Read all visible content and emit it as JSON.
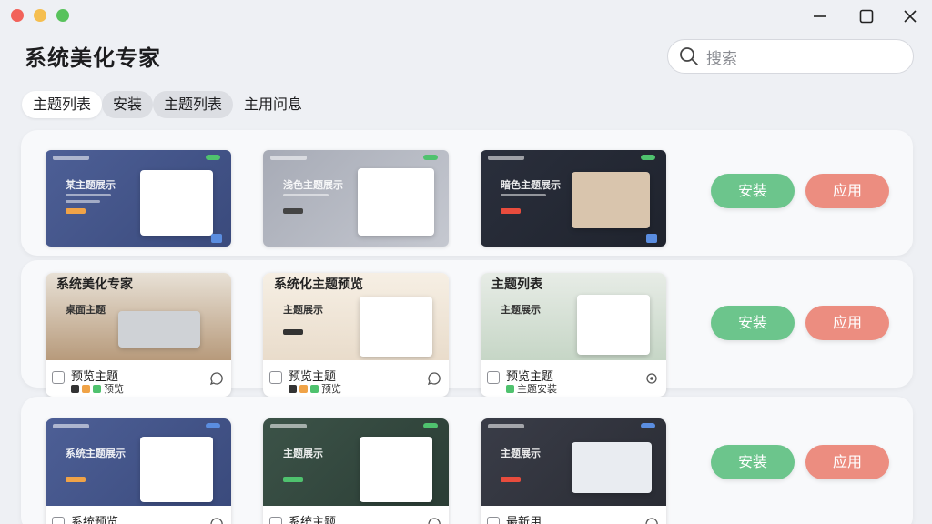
{
  "app": {
    "title": "系统美化专家"
  },
  "search": {
    "placeholder": "搜索"
  },
  "tabs": [
    {
      "label": "主题列表"
    },
    {
      "label": "安装"
    },
    {
      "label": "主题列表"
    },
    {
      "label": "主用问息"
    }
  ],
  "rows": [
    {
      "install_label": "安装",
      "apply_label": "应用",
      "thumbs": [
        {
          "heading": "某主题展示"
        },
        {
          "heading": "浅色主题展示"
        },
        {
          "heading": "暗色主题展示"
        }
      ]
    },
    {
      "install_label": "安装",
      "apply_label": "应用",
      "tiles": [
        {
          "overlay_title": "系统美化专家",
          "heading": "桌面主题",
          "name": "预览主题",
          "meta": "预览"
        },
        {
          "overlay_title": "系统化主题预览",
          "heading": "主题展示",
          "name": "预览主题",
          "meta": "预览"
        },
        {
          "overlay_title": "主题列表",
          "heading": "主题展示",
          "name": "预览主题",
          "meta": "主题安装"
        }
      ]
    },
    {
      "install_label": "安装",
      "apply_label": "应用",
      "tiles": [
        {
          "heading": "系统主题展示",
          "name": "系统预览"
        },
        {
          "heading": "主题展示",
          "name": "系统主题"
        },
        {
          "heading": "主题展示",
          "name": "最新用"
        }
      ]
    }
  ],
  "colors": {
    "install": "#6cc58c",
    "apply": "#ec8d80",
    "background": "#eef0f4"
  }
}
